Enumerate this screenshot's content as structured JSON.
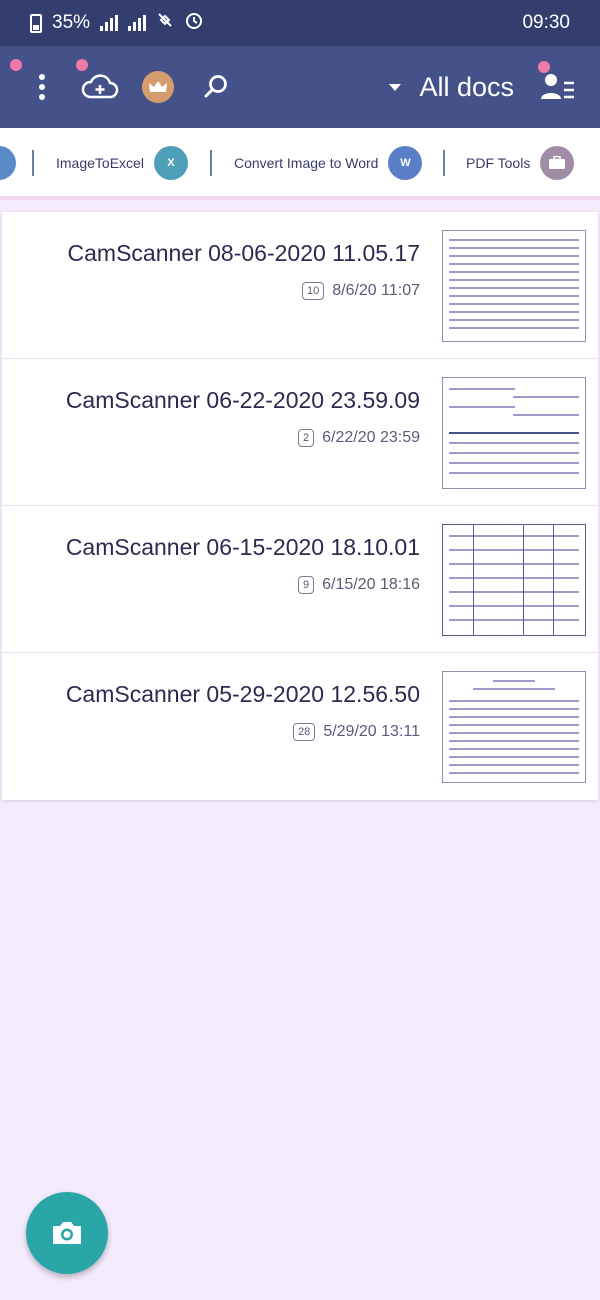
{
  "status_bar": {
    "battery_percent": "35%",
    "time": "09:30"
  },
  "header": {
    "title": "All docs",
    "icons": [
      "more-vert-icon",
      "cloud-add-icon",
      "crown-icon",
      "search-icon",
      "user-menu-icon"
    ]
  },
  "tools": [
    {
      "label": "PDF Tools",
      "icon": "briefcase-icon"
    },
    {
      "label": "Convert Image to Word",
      "icon": "word-icon"
    },
    {
      "label": "ImageToExcel",
      "icon": "excel-icon"
    }
  ],
  "documents": [
    {
      "title": "CamScanner 08-06-2020 11.05.17",
      "date": "8/6/20 11:07",
      "pages": "10"
    },
    {
      "title": "CamScanner 06-22-2020 23.59.09",
      "date": "6/22/20 23:59",
      "pages": "2"
    },
    {
      "title": "CamScanner 06-15-2020 18.10.01",
      "date": "6/15/20 18:16",
      "pages": "9"
    },
    {
      "title": "CamScanner 05-29-2020 12.56.50",
      "date": "5/29/20 13:11",
      "pages": "28"
    }
  ],
  "colors": {
    "status_bar": "#333d6e",
    "app_bar": "#45528a",
    "fab": "#2aa6a9",
    "background": "#f3eafb"
  }
}
